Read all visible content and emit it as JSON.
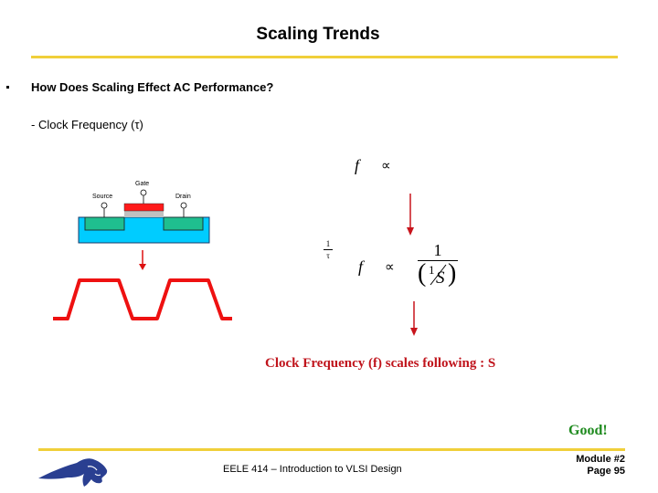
{
  "slide": {
    "title": "Scaling Trends",
    "bullet": "How Does Scaling Effect AC Performance?",
    "sub_point": "- Clock Frequency  (τ)",
    "diagram": {
      "gate_label": "Gate",
      "source_label": "Source",
      "drain_label": "Drain",
      "colors": {
        "substrate": "#00ccff",
        "diffusion": "#1fbf8f",
        "gate_poly": "#ff1a1a",
        "gate_oxide": "#c0c0c0",
        "waveform": "#ee1111"
      }
    },
    "equations": {
      "eq1_lhs": "f",
      "eq1_op": "∝",
      "tau_num": "1",
      "tau_den": "τ",
      "eq2_lhs": "f",
      "eq2_op": "∝",
      "eq2_num": "1",
      "eq2_inner_num": "1",
      "eq2_inner_den": "S"
    },
    "conclusion": "Clock Frequency (f) scales following : S",
    "verdict": "Good!"
  },
  "footer": {
    "course": "EELE 414 – Introduction to VLSI Design",
    "module": "Module #2",
    "page": "Page 95",
    "logo": "bobcat-logo"
  }
}
